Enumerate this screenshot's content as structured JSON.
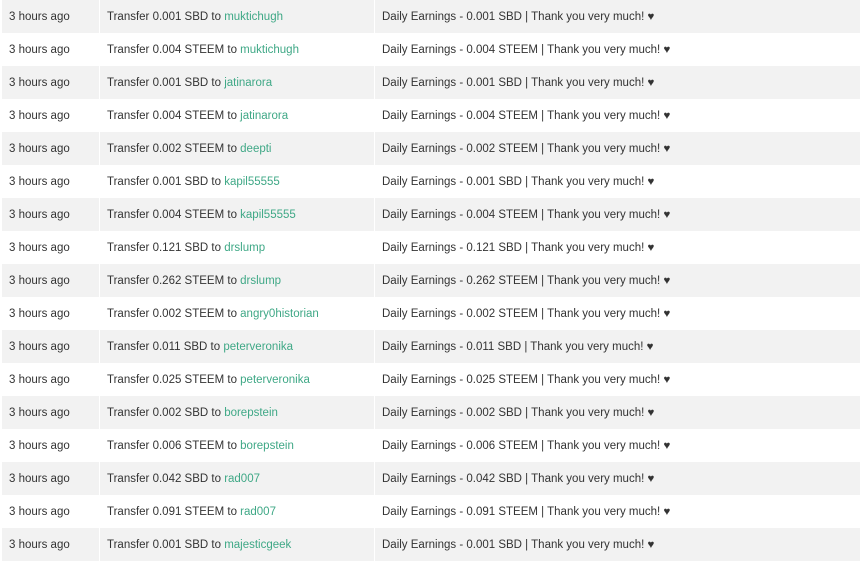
{
  "history": {
    "rows": [
      {
        "time": "3 hours ago",
        "transfer_prefix": "Transfer 0.001 SBD to ",
        "account": "muktichugh",
        "memo": "Daily Earnings - 0.001 SBD | Thank you very much! ♥"
      },
      {
        "time": "3 hours ago",
        "transfer_prefix": "Transfer 0.004 STEEM to ",
        "account": "muktichugh",
        "memo": "Daily Earnings - 0.004 STEEM | Thank you very much! ♥"
      },
      {
        "time": "3 hours ago",
        "transfer_prefix": "Transfer 0.001 SBD to ",
        "account": "jatinarora",
        "memo": "Daily Earnings - 0.001 SBD | Thank you very much! ♥"
      },
      {
        "time": "3 hours ago",
        "transfer_prefix": "Transfer 0.004 STEEM to ",
        "account": "jatinarora",
        "memo": "Daily Earnings - 0.004 STEEM | Thank you very much! ♥"
      },
      {
        "time": "3 hours ago",
        "transfer_prefix": "Transfer 0.002 STEEM to ",
        "account": "deepti",
        "memo": "Daily Earnings - 0.002 STEEM | Thank you very much! ♥"
      },
      {
        "time": "3 hours ago",
        "transfer_prefix": "Transfer 0.001 SBD to ",
        "account": "kapil55555",
        "memo": "Daily Earnings - 0.001 SBD | Thank you very much! ♥"
      },
      {
        "time": "3 hours ago",
        "transfer_prefix": "Transfer 0.004 STEEM to ",
        "account": "kapil55555",
        "memo": "Daily Earnings - 0.004 STEEM | Thank you very much! ♥"
      },
      {
        "time": "3 hours ago",
        "transfer_prefix": "Transfer 0.121 SBD to ",
        "account": "drslump",
        "memo": "Daily Earnings - 0.121 SBD | Thank you very much! ♥"
      },
      {
        "time": "3 hours ago",
        "transfer_prefix": "Transfer 0.262 STEEM to ",
        "account": "drslump",
        "memo": "Daily Earnings - 0.262 STEEM | Thank you very much! ♥"
      },
      {
        "time": "3 hours ago",
        "transfer_prefix": "Transfer 0.002 STEEM to ",
        "account": "angry0historian",
        "memo": "Daily Earnings - 0.002 STEEM | Thank you very much! ♥"
      },
      {
        "time": "3 hours ago",
        "transfer_prefix": "Transfer 0.011 SBD to ",
        "account": "peterveronika",
        "memo": "Daily Earnings - 0.011 SBD | Thank you very much! ♥"
      },
      {
        "time": "3 hours ago",
        "transfer_prefix": "Transfer 0.025 STEEM to ",
        "account": "peterveronika",
        "memo": "Daily Earnings - 0.025 STEEM | Thank you very much! ♥"
      },
      {
        "time": "3 hours ago",
        "transfer_prefix": "Transfer 0.002 SBD to ",
        "account": "borepstein",
        "memo": "Daily Earnings - 0.002 SBD | Thank you very much! ♥"
      },
      {
        "time": "3 hours ago",
        "transfer_prefix": "Transfer 0.006 STEEM to ",
        "account": "borepstein",
        "memo": "Daily Earnings - 0.006 STEEM | Thank you very much! ♥"
      },
      {
        "time": "3 hours ago",
        "transfer_prefix": "Transfer 0.042 SBD to ",
        "account": "rad007",
        "memo": "Daily Earnings - 0.042 SBD | Thank you very much! ♥"
      },
      {
        "time": "3 hours ago",
        "transfer_prefix": "Transfer 0.091 STEEM to ",
        "account": "rad007",
        "memo": "Daily Earnings - 0.091 STEEM | Thank you very much! ♥"
      },
      {
        "time": "3 hours ago",
        "transfer_prefix": "Transfer 0.001 SBD to ",
        "account": "majesticgeek",
        "memo": "Daily Earnings - 0.001 SBD | Thank you very much! ♥"
      }
    ]
  },
  "colors": {
    "account_link": "#3fa886",
    "row_stripe": "#f2f2f2",
    "text": "#333333"
  }
}
